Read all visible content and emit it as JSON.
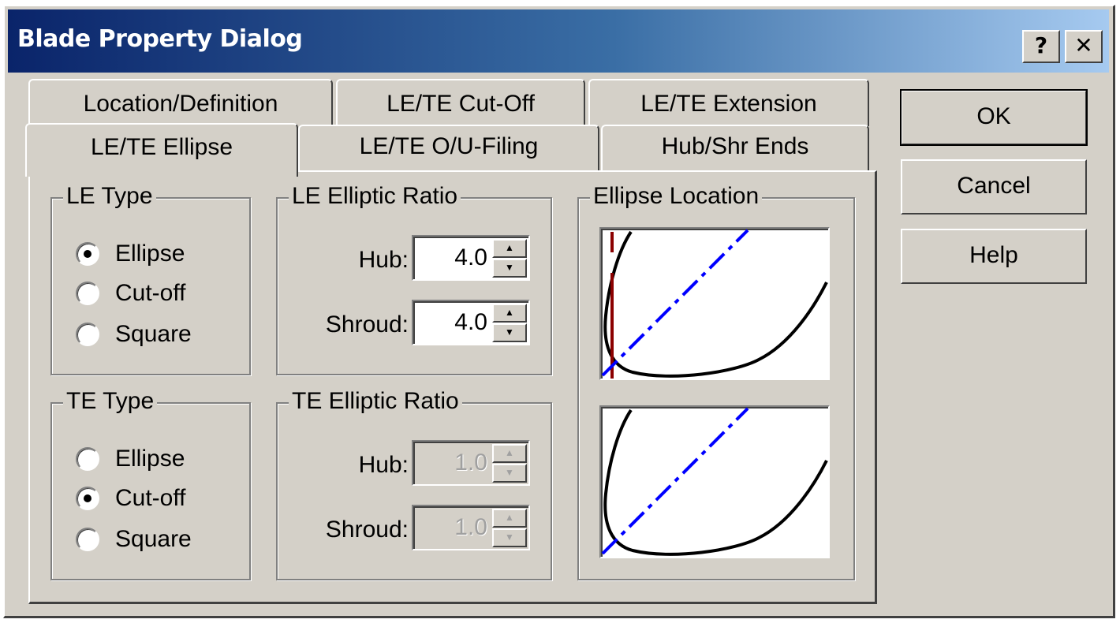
{
  "window": {
    "title": "Blade Property Dialog",
    "help_glyph": "?",
    "close_glyph": "✕"
  },
  "tabs": {
    "back_row": [
      "Location/Definition",
      "LE/TE Cut-Off",
      "LE/TE Extension"
    ],
    "front_row": [
      "LE/TE Ellipse",
      "LE/TE O/U-Filing",
      "Hub/Shr Ends"
    ],
    "active": "LE/TE Ellipse"
  },
  "le_type": {
    "title": "LE Type",
    "options": [
      "Ellipse",
      "Cut-off",
      "Square"
    ],
    "selected": "Ellipse"
  },
  "te_type": {
    "title": "TE Type",
    "options": [
      "Ellipse",
      "Cut-off",
      "Square"
    ],
    "selected": "Cut-off"
  },
  "le_ratio": {
    "title": "LE Elliptic Ratio",
    "hub_label": "Hub:",
    "hub_value": "4.0",
    "shroud_label": "Shroud:",
    "shroud_value": "4.0"
  },
  "te_ratio": {
    "title": "TE Elliptic Ratio",
    "hub_label": "Hub:",
    "hub_value": "1.0",
    "shroud_label": "Shroud:",
    "shroud_value": "1.0"
  },
  "ellipse_location": {
    "title": "Ellipse Location"
  },
  "buttons": {
    "ok": "OK",
    "cancel": "Cancel",
    "help": "Help"
  },
  "colors": {
    "face": "#d4d0c8",
    "title_start": "#0a246a",
    "title_end": "#a6caf0",
    "curve": "#000000",
    "dash_line": "#0000ff",
    "marker_line": "#8b0000"
  }
}
